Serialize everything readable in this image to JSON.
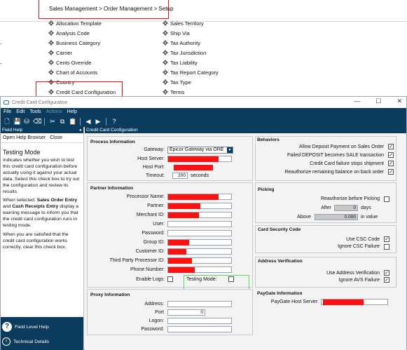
{
  "breadcrumb": "Sales Management > Order Management > Setup",
  "setup_left": [
    "Allocation Template",
    "Analysis Code",
    "Business Category",
    "Carrier",
    "Cents Override",
    "Chart of Accounts",
    "Country",
    "Credit Card Configuration"
  ],
  "setup_right": [
    "Sales Territory",
    "Ship Via",
    "Tax Authority",
    "Tax Jurisdiction",
    "Tax Liability",
    "Tax Report Category",
    "Tax Type",
    "Terms"
  ],
  "window": {
    "title": "Credit Card Configuration"
  },
  "menu": {
    "file": "File",
    "edit": "Edit",
    "tools": "Tools",
    "actions": "Actions",
    "help": "Help"
  },
  "left_panel": {
    "header": "Field Help",
    "open_help_browser": "Open Help Browser",
    "close": "Close",
    "help_title": "Testing Mode",
    "p1": "Indicates whether you wish to test this credit card configuration before actually using it against your actual data. Select this check box to try out the configuration and review its results.",
    "p2_pre": "When selected, ",
    "p2_b1": "Sales Order Entry",
    "p2_mid": " and ",
    "p2_b2": "Cash Receipts Entry",
    "p2_post": " display a warning message to inform you that the credit card configuration runs in testing mode.",
    "p3": "When you are satisfied that the credit card configuration works correctly, clear this check box.",
    "field_level_help": "Field Level Help",
    "technical_details": "Technical Details"
  },
  "right_header": "Credit Card Configuration",
  "process": {
    "title": "Process Information",
    "gateway_label": "Gateway:",
    "gateway_value": "Epicor Gateway via ORE",
    "host_server_label": "Host Server:",
    "host_port_label": "Host Port:",
    "timeout_label": "Timeout:",
    "timeout_value": "200",
    "timeout_unit": "seconds"
  },
  "partner": {
    "title": "Partner Information",
    "processor_name": "Processor Name:",
    "partner": "Partner:",
    "merchant_id": "Merchant ID:",
    "user": "User:",
    "password": "Password:",
    "group_id": "Group ID:",
    "customer_id": "Customer ID:",
    "third_party_processor_id": "Third Party Processor ID:",
    "phone_number": "Phone Number:",
    "enable_logs": "Enable Logs:",
    "testing_mode": "Testing Mode:"
  },
  "proxy": {
    "title": "Proxy Information",
    "address": "Address:",
    "port": "Port",
    "port_value": "0",
    "logon": "Logon:",
    "password": "Password:"
  },
  "behaviors": {
    "title": "Behaviors",
    "items": [
      "Allow Deposit Payment on Sales Order",
      "Failed DEPOSIT becomes SALE transaction",
      "Credit Card failure stops shipment",
      "Reauthorize remaining balance on back order"
    ]
  },
  "picking": {
    "title": "Picking",
    "reauthorize": "Reauthorize before Picking",
    "after_label": "After",
    "after_value": "0",
    "after_unit": "days",
    "above_label": "Above",
    "above_value": "0.000",
    "above_unit": "in value"
  },
  "csc": {
    "title": "Card Security Code",
    "use_csc": "Use CSC Code",
    "ignore_csc": "Ignore CSC Failure"
  },
  "address_verification": {
    "title": "Address Verification",
    "use_av": "Use Address Verification",
    "ignore_avs": "Ignore AVS Failure"
  },
  "paygate": {
    "title": "PayGate Information",
    "host_server": "PayGate Host Server:"
  },
  "colors": {
    "nav_blue": "#0b3c5d",
    "highlight_red": "#e0151b",
    "redaction": "#ff1010",
    "green_box": "#5ed65e"
  }
}
